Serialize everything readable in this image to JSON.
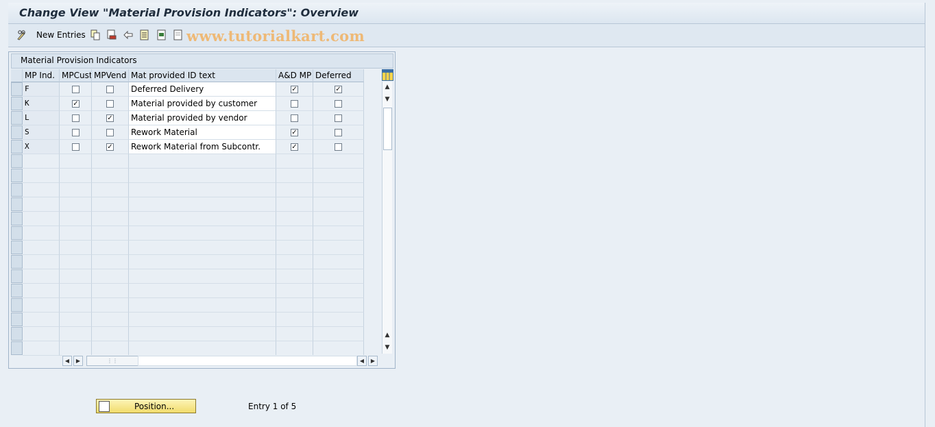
{
  "window": {
    "title": "Change View \"Material Provision Indicators\": Overview"
  },
  "toolbar": {
    "new_entries_label": "New Entries",
    "watermark": "www.tutorialkart.com"
  },
  "panel": {
    "title": "Material Provision Indicators"
  },
  "table": {
    "headers": [
      "MP Ind.",
      "MPCust",
      "MPVend",
      "Mat provided ID text",
      "A&D MP",
      "Deferred"
    ],
    "rows": [
      {
        "ind": "F",
        "mpcust": false,
        "mpvend": false,
        "text": "Deferred Delivery",
        "adm": true,
        "deferred": true
      },
      {
        "ind": "K",
        "mpcust": true,
        "mpvend": false,
        "text": "Material provided by customer",
        "adm": false,
        "deferred": false
      },
      {
        "ind": "L",
        "mpcust": false,
        "mpvend": true,
        "text": "Material provided by vendor",
        "adm": false,
        "deferred": false
      },
      {
        "ind": "S",
        "mpcust": false,
        "mpvend": false,
        "text": "Rework Material",
        "adm": true,
        "deferred": false
      },
      {
        "ind": "X",
        "mpcust": false,
        "mpvend": true,
        "text": "Rework Material from Subcontr.",
        "adm": true,
        "deferred": false
      }
    ],
    "total_rows": 19
  },
  "footer": {
    "position_label": "Position...",
    "entry_text": "Entry 1 of 5"
  },
  "colors": {
    "header_bg": "#dbe5ef",
    "button_bg": "#f1dc6c",
    "watermark": "#f0b469"
  }
}
